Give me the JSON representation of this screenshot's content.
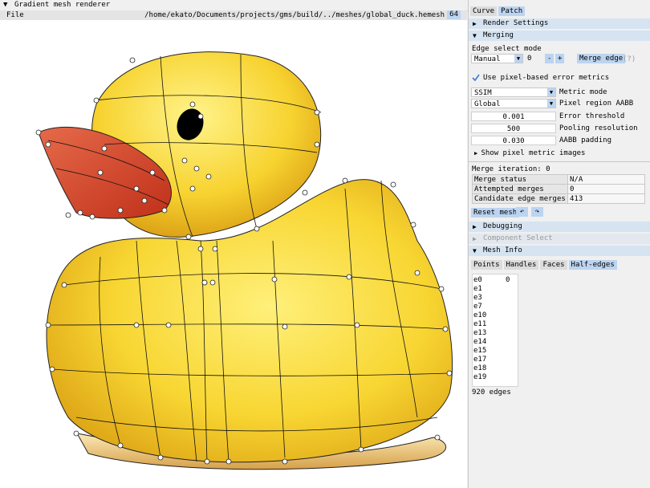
{
  "window": {
    "title": "Gradient mesh renderer"
  },
  "menubar": {
    "file": "File",
    "path": "/home/ekato/Documents/projects/gms/build/../meshes/global_duck.hemesh",
    "fps": "64"
  },
  "panel": {
    "tabs": [
      "Curve",
      "Patch"
    ],
    "render_settings": "Render Settings",
    "merging": "Merging",
    "edge_select_mode_label": "Edge select mode",
    "edge_select_mode_value": "Manual",
    "edge_count": "0",
    "minus": "-",
    "plus": "+",
    "merge_edge": "Merge edge",
    "help": "(?)",
    "use_pixel_metrics": "Use pixel-based error metrics",
    "metric_mode_value": "SSIM",
    "metric_mode_label": "Metric mode",
    "pixel_region_value": "Global",
    "pixel_region_label": "Pixel region AABB",
    "error_threshold_value": "0.001",
    "error_threshold_label": "Error threshold",
    "pooling_value": "500",
    "pooling_label": "Pooling resolution",
    "aabb_padding_value": "0.030",
    "aabb_padding_label": "AABB padding",
    "show_pixel_images": "Show pixel metric images",
    "merge_iteration": "Merge iteration: 0",
    "status_rows": [
      {
        "k": "Merge status",
        "v": "N/A"
      },
      {
        "k": "Attempted merges",
        "v": "0"
      },
      {
        "k": "Candidate edge merges",
        "v": "413"
      }
    ],
    "reset_mesh": "Reset mesh",
    "undo_icon": "undo-icon",
    "redo_icon": "redo-icon",
    "debugging": "Debugging",
    "component_select": "Component Select",
    "mesh_info": "Mesh Info",
    "info_tabs": [
      "Points",
      "Handles",
      "Faces",
      "Half-edges"
    ],
    "edges": [
      "e0",
      "e1",
      "e3",
      "e7",
      "e10",
      "e11",
      "e13",
      "e14",
      "e15",
      "e17",
      "e18",
      "e19"
    ],
    "edges_scroll_marker": "0",
    "edge_count_text": "920 edges"
  }
}
